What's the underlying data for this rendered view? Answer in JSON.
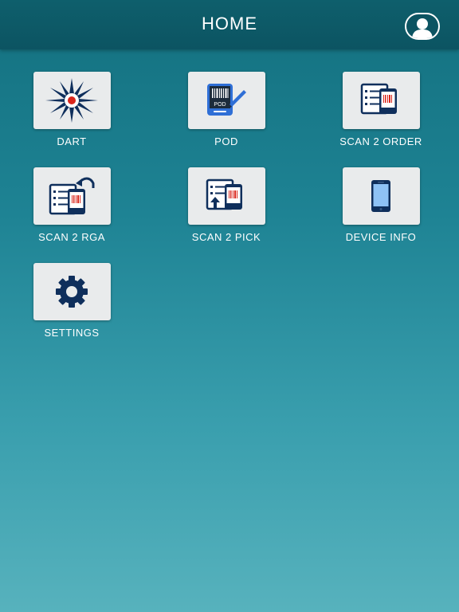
{
  "header": {
    "title": "HOME",
    "profile_icon": "user-profile-icon"
  },
  "tiles": [
    {
      "label": "DART",
      "icon": "dart-starburst-icon"
    },
    {
      "label": "POD",
      "icon": "pod-scanner-icon"
    },
    {
      "label": "SCAN 2 ORDER",
      "icon": "scan-order-icon"
    },
    {
      "label": "SCAN 2 RGA",
      "icon": "scan-rga-icon"
    },
    {
      "label": "SCAN 2 PICK",
      "icon": "scan-pick-icon"
    },
    {
      "label": "DEVICE INFO",
      "icon": "phone-device-icon"
    },
    {
      "label": "SETTINGS",
      "icon": "gear-icon"
    }
  ],
  "colors": {
    "header_bg": "#0c5462",
    "icon_navy": "#0f2f5c",
    "icon_blue": "#2f6fd6",
    "dart_red": "#d9261c",
    "tile_bg": "#e9ebec"
  }
}
